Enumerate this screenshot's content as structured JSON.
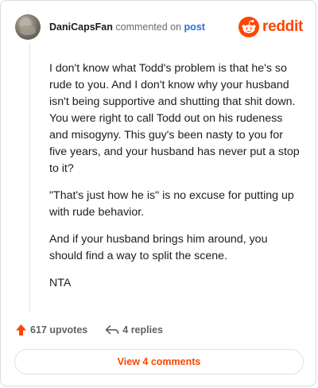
{
  "header": {
    "username": "DaniCapsFan",
    "action_text": "commented on",
    "post_link": "post",
    "brand": "reddit"
  },
  "comment": {
    "paragraphs": [
      "I don't know what Todd's problem is that he's so rude to you. And I don't know why your husband isn't being supportive and shutting that shit down. You were right to call Todd out on his rudeness and misogyny. This guy's been nasty to you for five years, and your husband has never put a stop to it?",
      "\"That's just how he is\" is no excuse for putting up with rude behavior.",
      "And if your husband brings him around, you should find a way to split the scene.",
      "NTA"
    ]
  },
  "footer": {
    "upvotes": "617 upvotes",
    "replies": "4 replies",
    "view_comments": "View 4 comments"
  },
  "colors": {
    "brand": "#ff4500",
    "link": "#2a6fd6"
  },
  "icons": {
    "avatar": "user-avatar",
    "logo": "reddit-alien-icon",
    "upvote": "upvote-arrow-icon",
    "reply": "reply-arrow-icon"
  }
}
